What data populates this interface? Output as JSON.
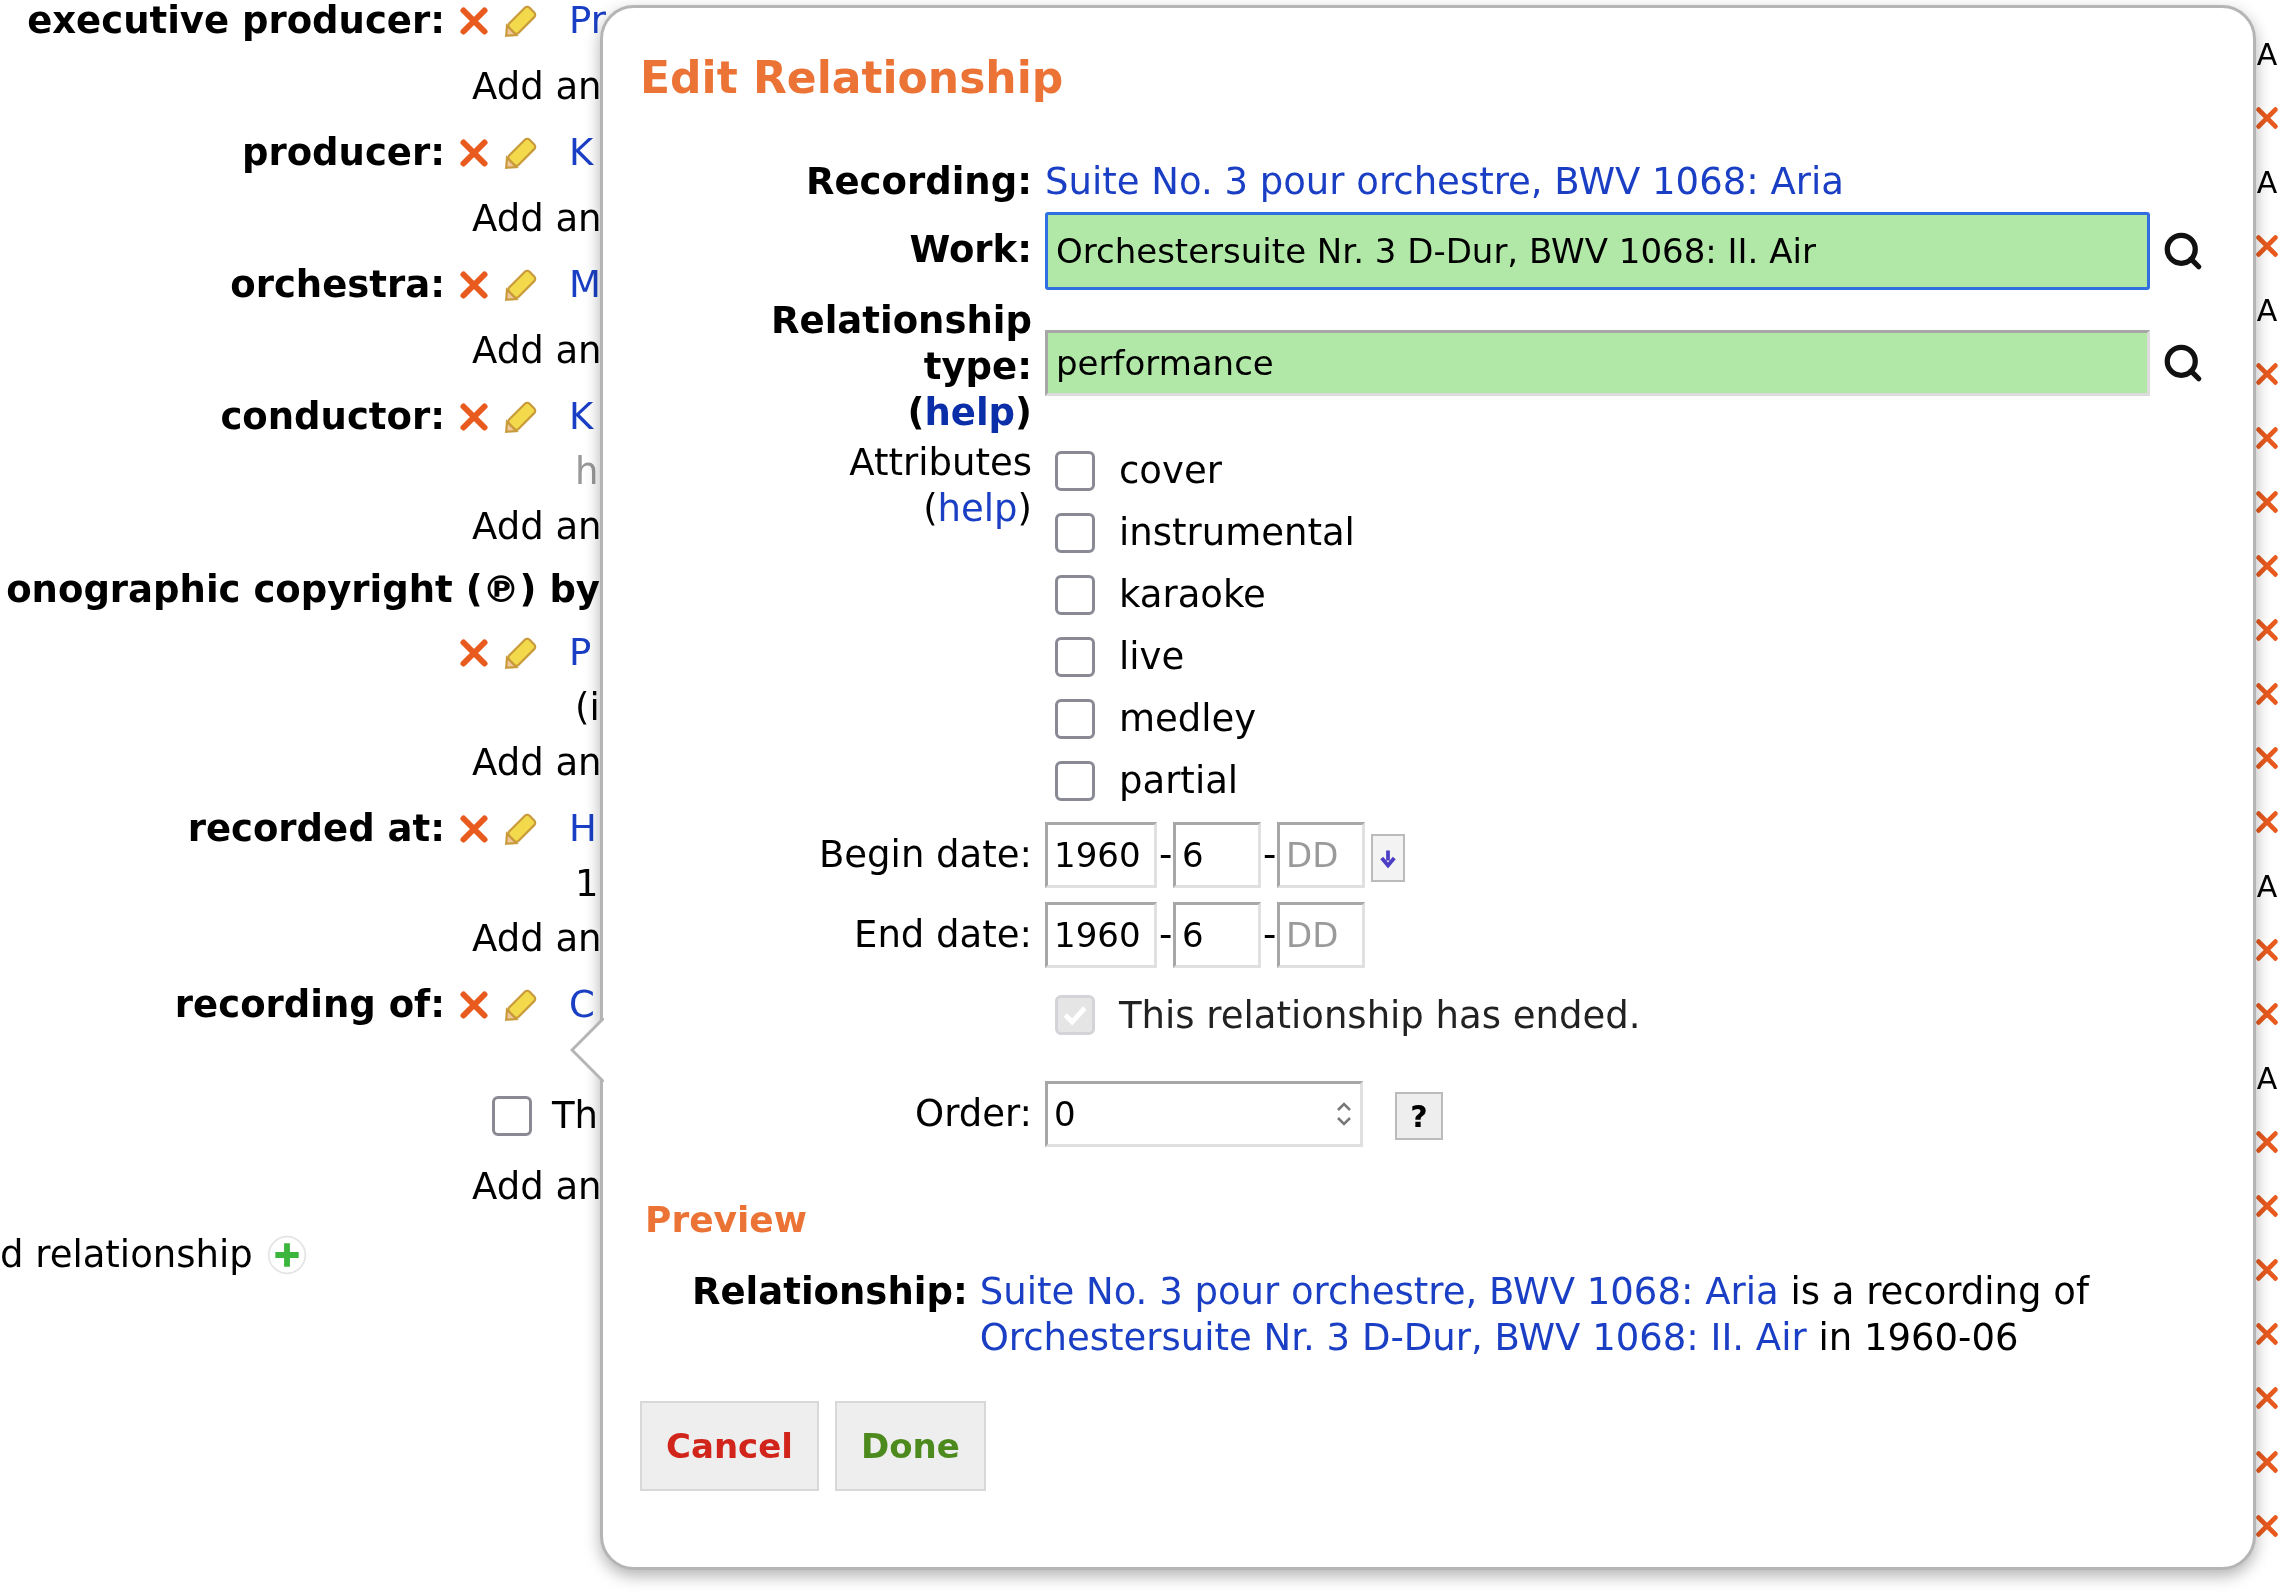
{
  "background": {
    "rows": [
      {
        "kind": "relation",
        "label": "executive producer:",
        "link": "Pr"
      },
      {
        "kind": "add",
        "text": "Add an"
      },
      {
        "kind": "relation",
        "label": "producer:",
        "link": "K"
      },
      {
        "kind": "add",
        "text": "Add an"
      },
      {
        "kind": "relation",
        "label": "orchestra:",
        "link": "M"
      },
      {
        "kind": "add",
        "text": "Add an"
      },
      {
        "kind": "relation",
        "label": "conductor:",
        "link": "K"
      },
      {
        "kind": "note",
        "text": "h",
        "muted": true
      },
      {
        "kind": "add",
        "text": "Add an"
      },
      {
        "kind": "heading",
        "text": "onographic copyright (℗) by"
      },
      {
        "kind": "relation",
        "link": "P"
      },
      {
        "kind": "note",
        "text": "(i",
        "muted": false
      },
      {
        "kind": "add",
        "text": "Add an"
      },
      {
        "kind": "relation",
        "label": "recorded at:",
        "link": "H"
      },
      {
        "kind": "note",
        "text": "1",
        "muted": false
      },
      {
        "kind": "add",
        "text": "Add an"
      },
      {
        "kind": "relation",
        "label": "recording of:",
        "link": "C"
      },
      {
        "kind": "checkbox",
        "text": "Th",
        "checked": false
      },
      {
        "kind": "add",
        "text": "Add an"
      },
      {
        "kind": "footer",
        "text": "d relationship"
      }
    ],
    "edge": [
      {
        "kind": "text",
        "text": "A"
      },
      {
        "kind": "remove"
      },
      {
        "kind": "text",
        "text": "A"
      },
      {
        "kind": "remove"
      },
      {
        "kind": "text",
        "text": "A"
      },
      {
        "kind": "remove"
      },
      {
        "kind": "remove"
      },
      {
        "kind": "remove"
      },
      {
        "kind": "remove"
      },
      {
        "kind": "remove"
      },
      {
        "kind": "remove"
      },
      {
        "kind": "remove"
      },
      {
        "kind": "remove"
      },
      {
        "kind": "text",
        "text": "A"
      },
      {
        "kind": "remove"
      },
      {
        "kind": "remove"
      },
      {
        "kind": "text",
        "text": "A"
      },
      {
        "kind": "remove"
      },
      {
        "kind": "remove"
      },
      {
        "kind": "remove"
      },
      {
        "kind": "remove"
      },
      {
        "kind": "remove"
      },
      {
        "kind": "remove"
      },
      {
        "kind": "remove"
      }
    ]
  },
  "dialog": {
    "title": "Edit Relationship",
    "recording": {
      "label": "Recording:",
      "link": "Suite No. 3 pour orchestre, BWV 1068: Aria"
    },
    "work": {
      "label": "Work:",
      "value": "Orchestersuite Nr. 3 D-Dur, BWV 1068: II. Air",
      "focused": true
    },
    "relationship_type": {
      "label": "Relationship type:",
      "help": {
        "open": "(",
        "link": "help",
        "close": ")"
      },
      "value": "performance",
      "focused": false
    },
    "attributes": {
      "label": "Attributes",
      "help": {
        "open": "(",
        "link": "help",
        "close": ")"
      },
      "items": [
        {
          "label": "cover",
          "checked": false
        },
        {
          "label": "instrumental",
          "checked": false
        },
        {
          "label": "karaoke",
          "checked": false
        },
        {
          "label": "live",
          "checked": false
        },
        {
          "label": "medley",
          "checked": false
        },
        {
          "label": "partial",
          "checked": false
        }
      ]
    },
    "begin_date": {
      "label": "Begin date:",
      "year": "1960",
      "month": "6",
      "day_placeholder": "DD",
      "separator": "-",
      "picker": true
    },
    "end_date": {
      "label": "End date:",
      "year": "1960",
      "month": "6",
      "day_placeholder": "DD",
      "separator": "-",
      "picker": false
    },
    "ended": {
      "label": "This relationship has ended.",
      "checked": true,
      "disabled": true
    },
    "order": {
      "label": "Order:",
      "value": "0",
      "help_button": "?"
    },
    "preview": {
      "heading": "Preview",
      "label": "Relationship:",
      "parts": [
        {
          "kind": "link",
          "text": "Suite No. 3 pour orchestre, BWV 1068: Aria"
        },
        {
          "kind": "text",
          "text": " is a recording of "
        },
        {
          "kind": "link",
          "text": "Orchestersuite Nr. 3 D-Dur, BWV 1068: II. Air"
        },
        {
          "kind": "text",
          "text": " in 1960-06"
        }
      ]
    },
    "buttons": [
      {
        "label": "Cancel",
        "kind": "cancel"
      },
      {
        "label": "Done",
        "kind": "done"
      }
    ]
  }
}
